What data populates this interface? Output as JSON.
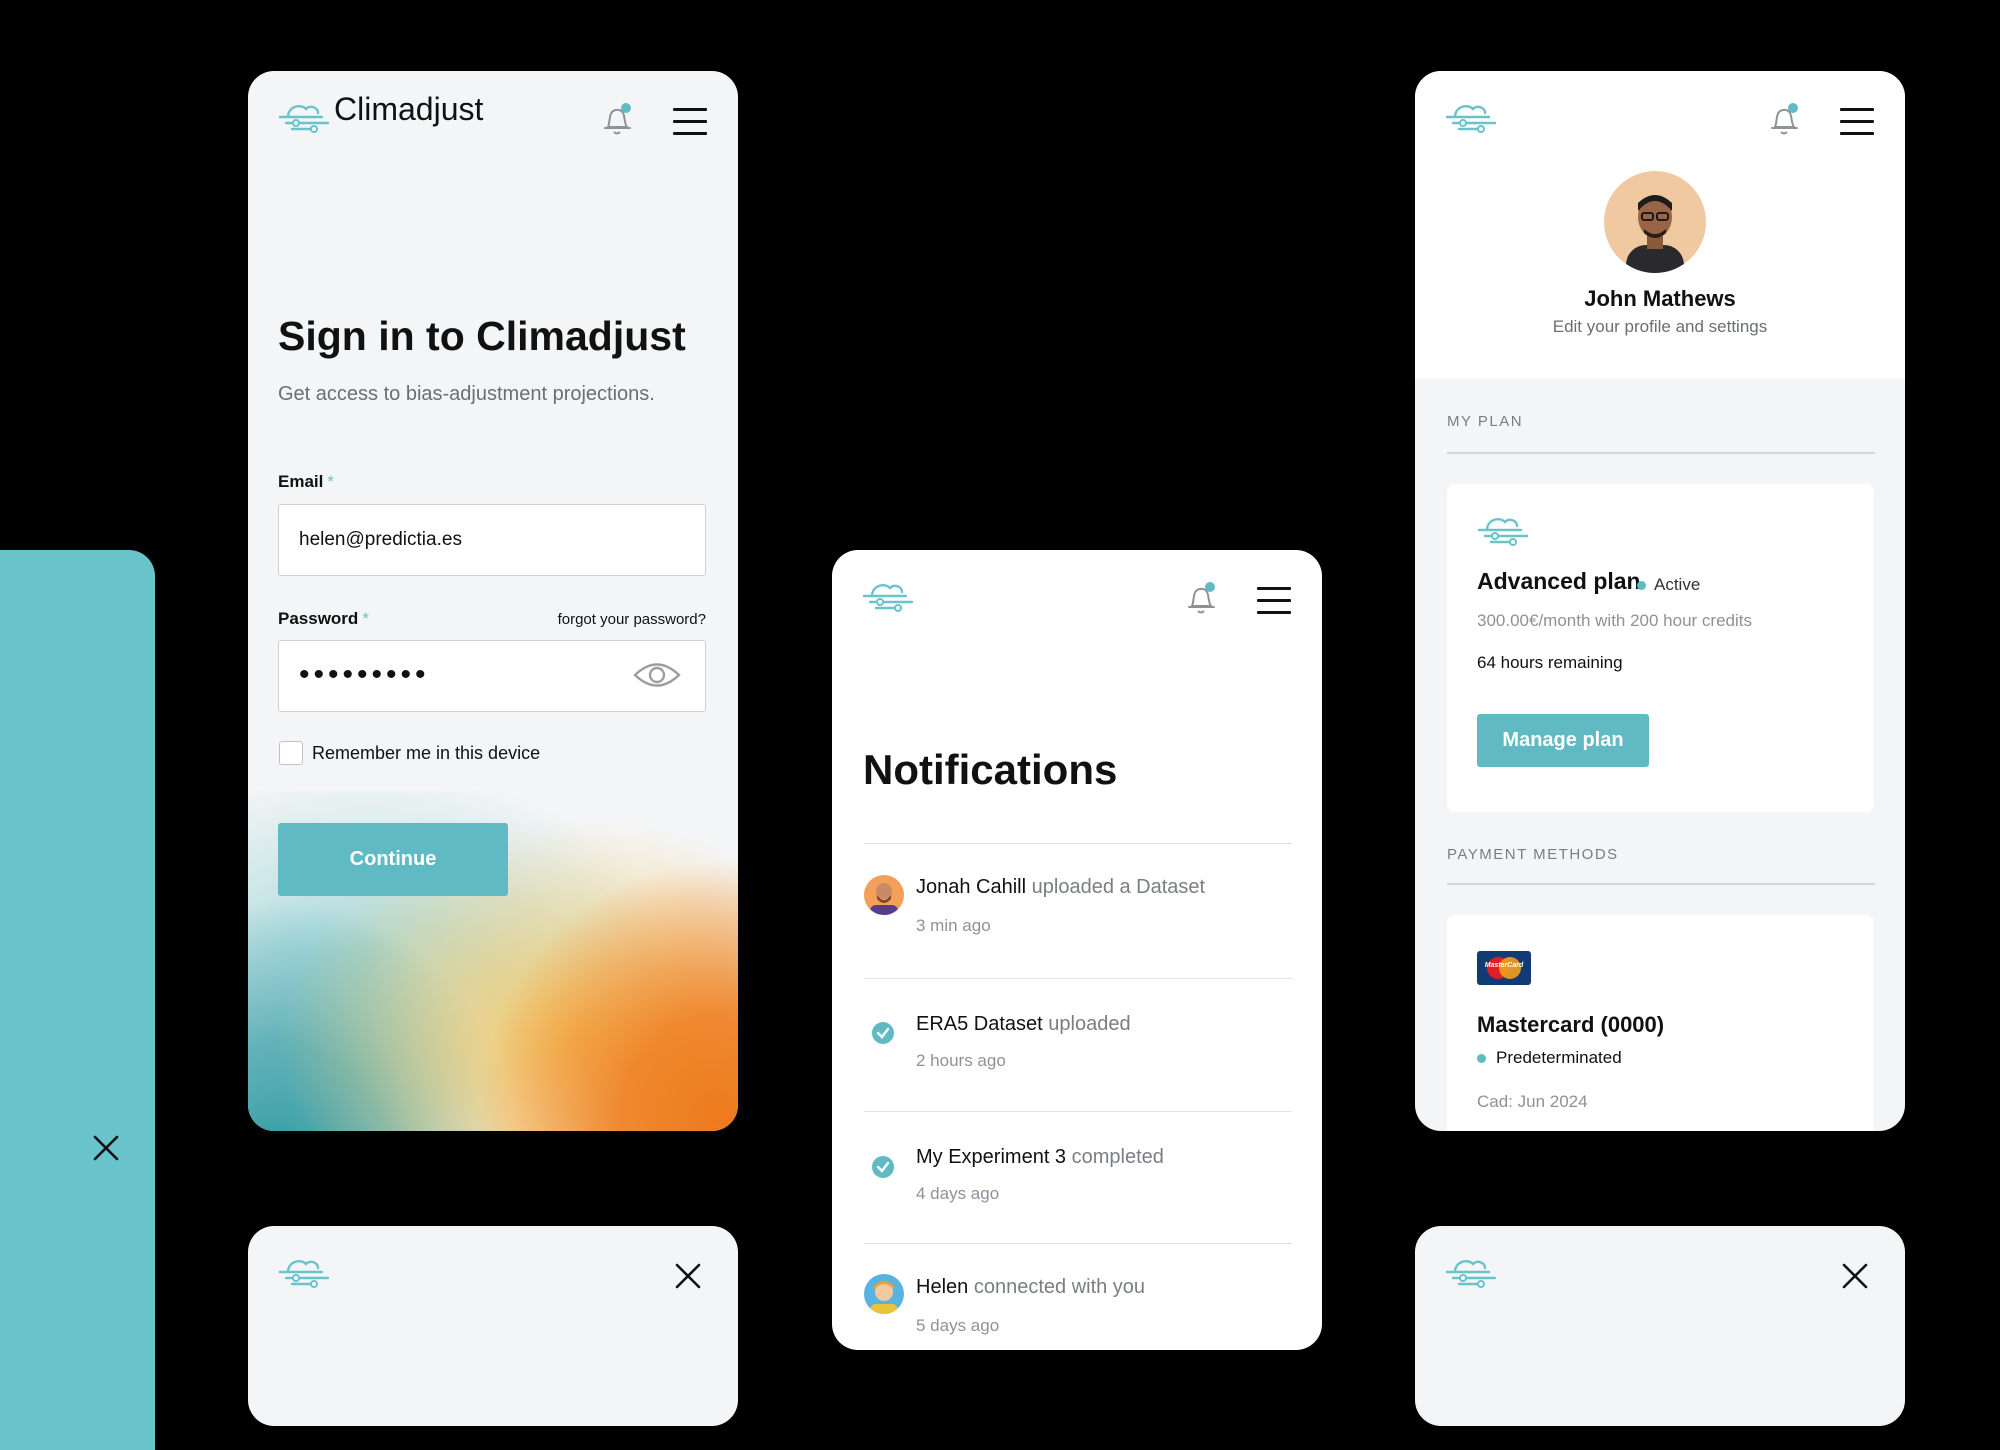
{
  "brand": {
    "name": "Climadjust",
    "accent": "#69c3cb",
    "button_color": "#5fbac4",
    "icon": "cloud-wind-logo-icon"
  },
  "signin": {
    "title": "Sign in to Climadjust",
    "subtitle": "Get access to bias-adjustment projections.",
    "email_label": "Email",
    "email_value": "helen@predictia.es",
    "password_label": "Password",
    "forgot_link": "forgot your password?",
    "password_mask": "•••••••••",
    "remember_label": "Remember me in this device",
    "remember_checked": false,
    "continue_label": "Continue",
    "required_mark": "*"
  },
  "notifications": {
    "title": "Notifications",
    "items": [
      {
        "actor": "Jonah Cahill",
        "action": "uploaded a Dataset",
        "time": "3 min ago",
        "icon": "avatar"
      },
      {
        "actor": "ERA5 Dataset",
        "action": "uploaded",
        "time": "2 hours ago",
        "icon": "check-circle-icon"
      },
      {
        "actor": "My Experiment 3",
        "action": "completed",
        "time": "4 days ago",
        "icon": "check-circle-icon"
      },
      {
        "actor": "Helen",
        "action": "connected with you",
        "time": "5 days ago",
        "icon": "avatar"
      }
    ]
  },
  "profile": {
    "name": "John Mathews",
    "subtitle": "Edit your profile and settings",
    "my_plan_label": "MY PLAN",
    "plan": {
      "name": "Advanced plan",
      "status": "Active",
      "price": "300.00€/month with 200 hour credits",
      "remaining": "64 hours remaining",
      "manage_label": "Manage plan"
    },
    "payment_label": "PAYMENT METHODS",
    "card": {
      "name": "Mastercard (0000)",
      "status": "Predeterminated",
      "expiry": "Cad: Jun 2024",
      "logo_text": "MasterCard"
    }
  }
}
